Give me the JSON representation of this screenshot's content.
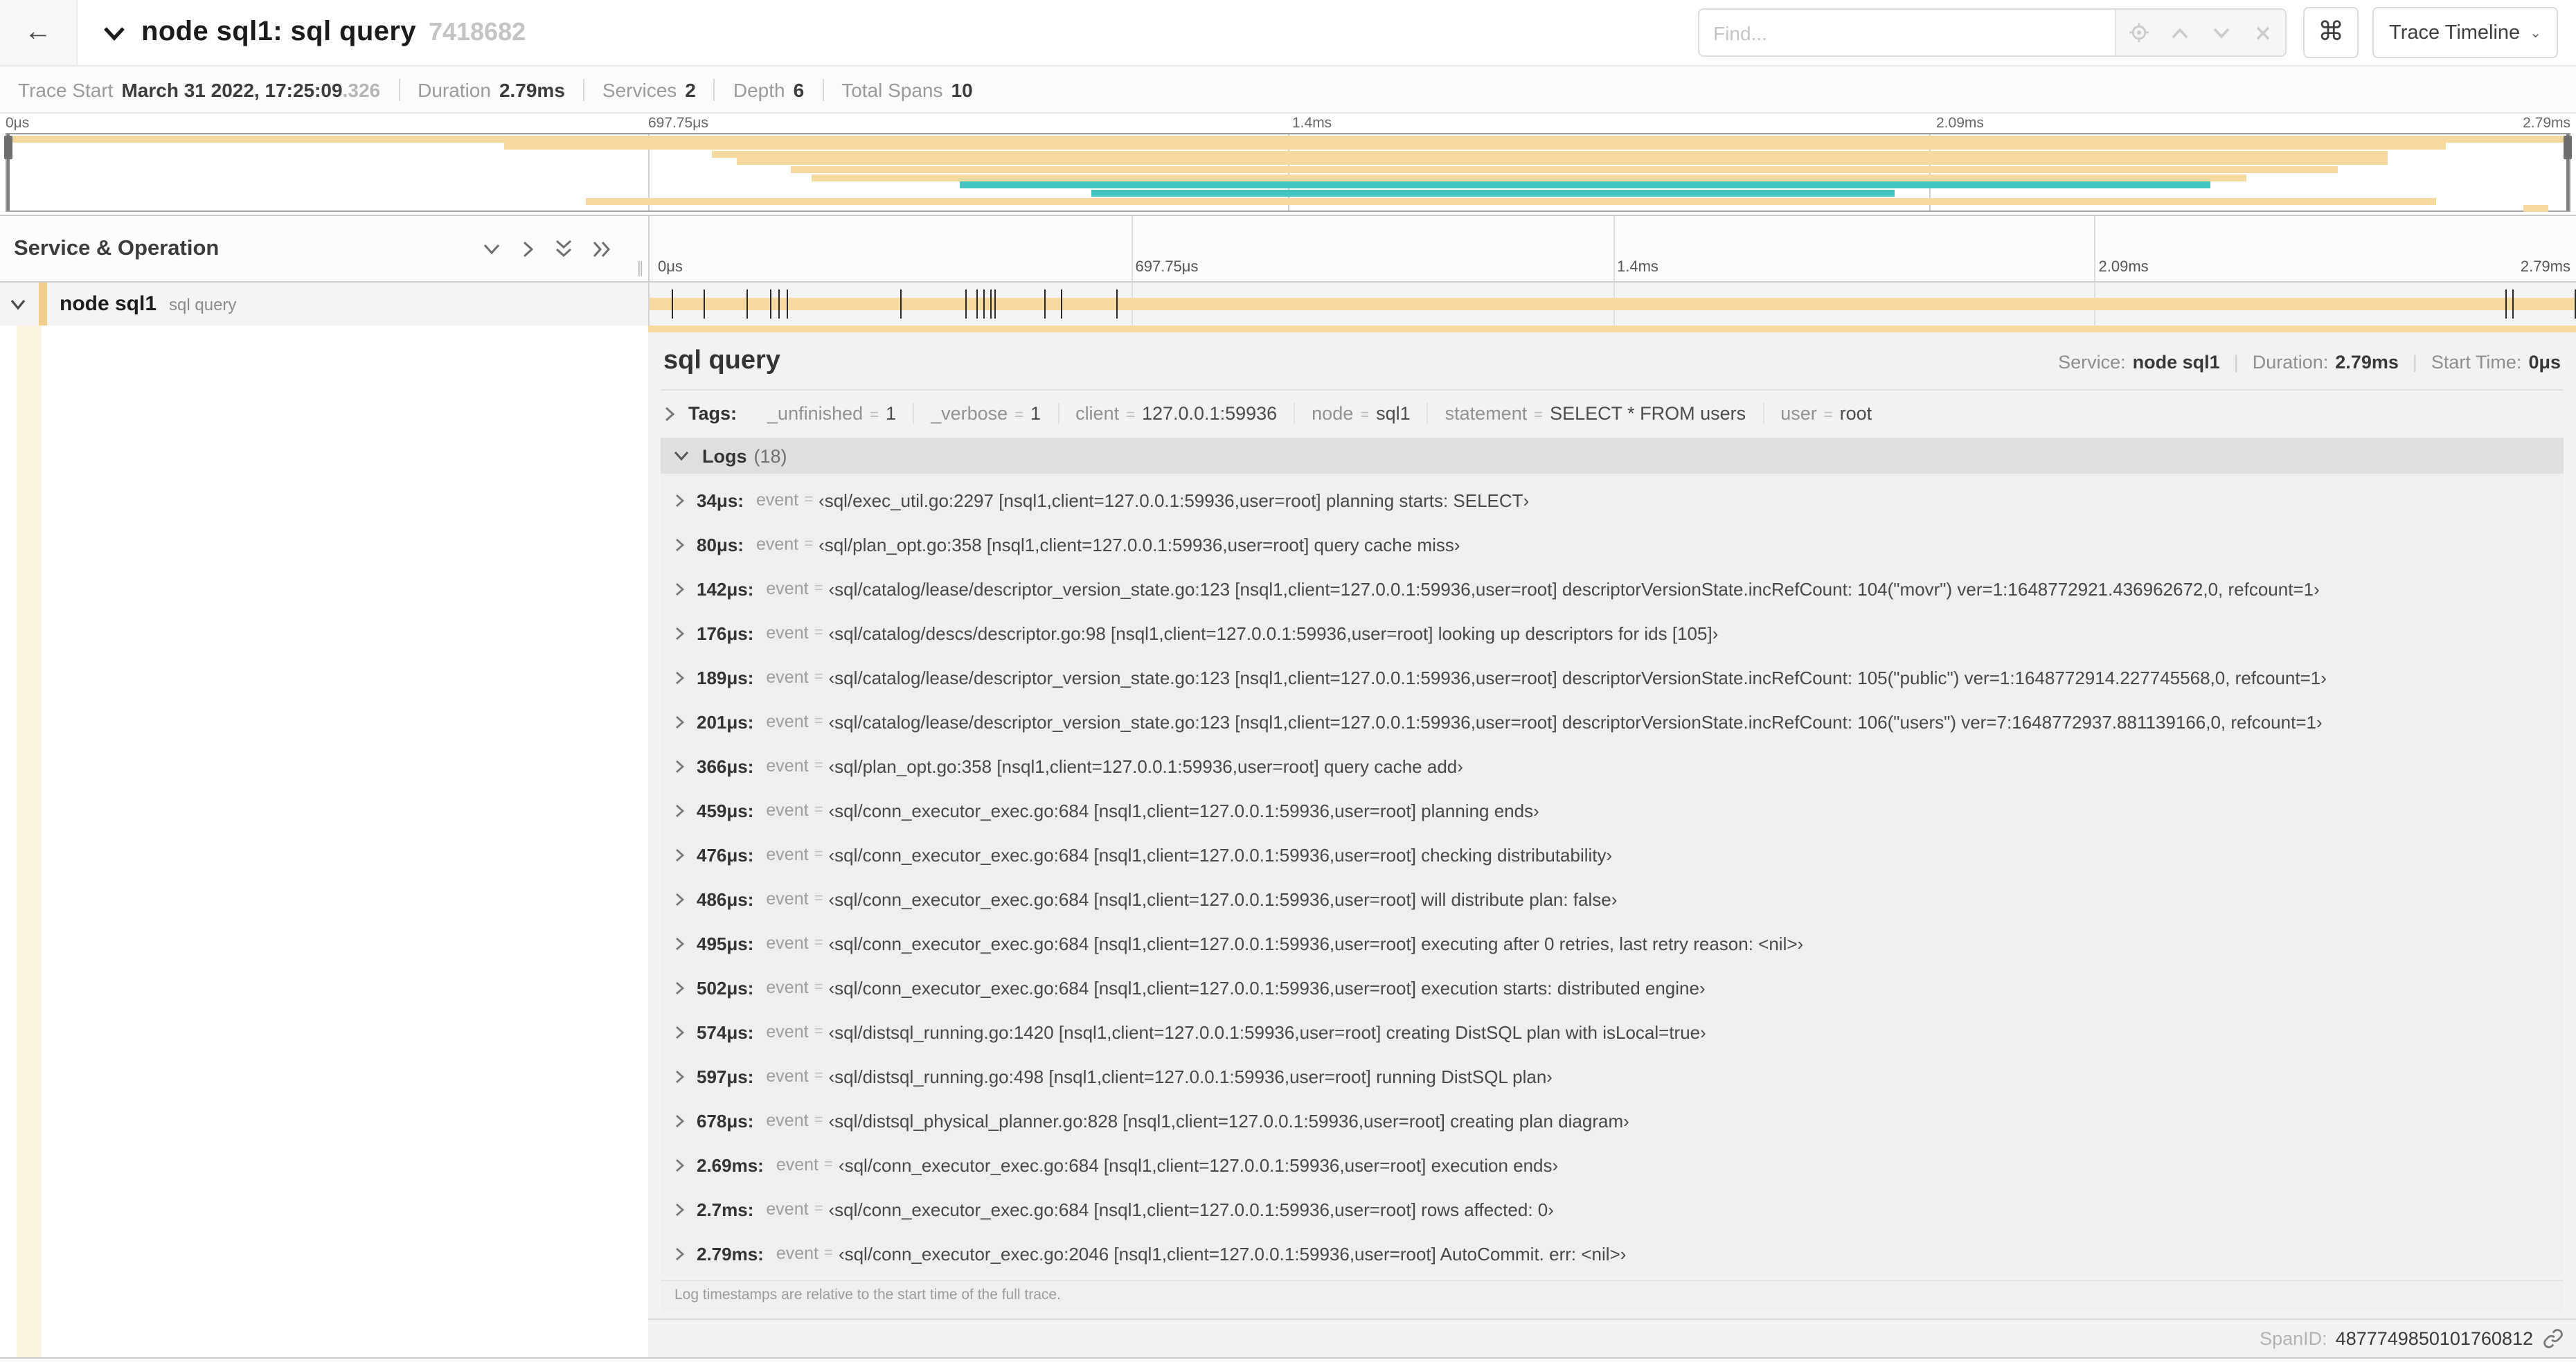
{
  "colors": {
    "tan": "#F5D9A0",
    "teal": "#41C5BF",
    "accent": "#F0CD8B",
    "cream": "#FBF4E2"
  },
  "header": {
    "back_label": "←",
    "title": "node sql1: sql query",
    "trace_id": "7418682",
    "find_placeholder": "Find...",
    "command_key": "⌘",
    "view_button_label": "Trace Timeline",
    "view_button_chevron": "⌄"
  },
  "summary": {
    "items": [
      {
        "label": "Trace Start",
        "value": "March 31 2022, 17:25:09",
        "muted": ".326"
      },
      {
        "label": "Duration",
        "value": "2.79ms",
        "muted": ""
      },
      {
        "label": "Services",
        "value": "2",
        "muted": ""
      },
      {
        "label": "Depth",
        "value": "6",
        "muted": ""
      },
      {
        "label": "Total Spans",
        "value": "10",
        "muted": ""
      }
    ]
  },
  "timeline": {
    "ticks": [
      {
        "label": "0μs",
        "pct": 0
      },
      {
        "label": "697.75μs",
        "pct": 25
      },
      {
        "label": "1.4ms",
        "pct": 50
      },
      {
        "label": "2.09ms",
        "pct": 75
      },
      {
        "label": "2.79ms",
        "pct": 100
      }
    ],
    "minimap_spans": [
      {
        "s": 0,
        "e": 100,
        "c": "tan"
      },
      {
        "s": 19.4,
        "e": 95.2,
        "c": "tan"
      },
      {
        "s": 27.5,
        "e": 92.9,
        "c": "tan"
      },
      {
        "s": 28.5,
        "e": 92.9,
        "c": "tan"
      },
      {
        "s": 30.6,
        "e": 91.0,
        "c": "tan"
      },
      {
        "s": 31.4,
        "e": 87.4,
        "c": "tan"
      },
      {
        "s": 37.2,
        "e": 86.0,
        "c": "teal"
      },
      {
        "s": 42.3,
        "e": 73.7,
        "c": "teal"
      },
      {
        "s": 22.6,
        "e": 94.8,
        "c": "tan"
      },
      {
        "s": 98.2,
        "e": 99.2,
        "c": "tan"
      }
    ],
    "left_title": "Service & Operation",
    "resizer_glyph": "∥"
  },
  "span_row": {
    "service": "node sql1",
    "operation": "sql query",
    "bar": {
      "s": 0,
      "e": 100,
      "c": "tan"
    },
    "log_marker_pcts": [
      1.22,
      2.87,
      5.09,
      6.31,
      6.77,
      7.2,
      13.12,
      16.45,
      17.06,
      17.42,
      17.74,
      18.0,
      20.57,
      21.4,
      24.3,
      96.42,
      96.77,
      100
    ]
  },
  "detail": {
    "title": "sql query",
    "meta": {
      "service_label": "Service:",
      "service": "node sql1",
      "duration_label": "Duration:",
      "duration": "2.79ms",
      "start_label": "Start Time:",
      "start": "0μs"
    },
    "tags_label": "Tags:",
    "tags": [
      {
        "key": "_unfinished",
        "value": "1"
      },
      {
        "key": "_verbose",
        "value": "1"
      },
      {
        "key": "client",
        "value": "127.0.0.1:59936"
      },
      {
        "key": "node",
        "value": "sql1"
      },
      {
        "key": "statement",
        "value": "SELECT * FROM users"
      },
      {
        "key": "user",
        "value": "root"
      }
    ],
    "logs": {
      "title": "Logs",
      "count": "(18)",
      "entries": [
        {
          "time": "34μs:",
          "key": "event",
          "value": "‹sql/exec_util.go:2297 [nsql1,client=127.0.0.1:59936,user=root] planning starts: SELECT›"
        },
        {
          "time": "80μs:",
          "key": "event",
          "value": "‹sql/plan_opt.go:358 [nsql1,client=127.0.0.1:59936,user=root] query cache miss›"
        },
        {
          "time": "142μs:",
          "key": "event",
          "value": "‹sql/catalog/lease/descriptor_version_state.go:123 [nsql1,client=127.0.0.1:59936,user=root] descriptorVersionState.incRefCount: 104(\"movr\") ver=1:1648772921.436962672,0, refcount=1›"
        },
        {
          "time": "176μs:",
          "key": "event",
          "value": "‹sql/catalog/descs/descriptor.go:98 [nsql1,client=127.0.0.1:59936,user=root] looking up descriptors for ids [105]›"
        },
        {
          "time": "189μs:",
          "key": "event",
          "value": "‹sql/catalog/lease/descriptor_version_state.go:123 [nsql1,client=127.0.0.1:59936,user=root] descriptorVersionState.incRefCount: 105(\"public\") ver=1:1648772914.227745568,0, refcount=1›"
        },
        {
          "time": "201μs:",
          "key": "event",
          "value": "‹sql/catalog/lease/descriptor_version_state.go:123 [nsql1,client=127.0.0.1:59936,user=root] descriptorVersionState.incRefCount: 106(\"users\") ver=7:1648772937.881139166,0, refcount=1›"
        },
        {
          "time": "366μs:",
          "key": "event",
          "value": "‹sql/plan_opt.go:358 [nsql1,client=127.0.0.1:59936,user=root] query cache add›"
        },
        {
          "time": "459μs:",
          "key": "event",
          "value": "‹sql/conn_executor_exec.go:684 [nsql1,client=127.0.0.1:59936,user=root] planning ends›"
        },
        {
          "time": "476μs:",
          "key": "event",
          "value": "‹sql/conn_executor_exec.go:684 [nsql1,client=127.0.0.1:59936,user=root] checking distributability›"
        },
        {
          "time": "486μs:",
          "key": "event",
          "value": "‹sql/conn_executor_exec.go:684 [nsql1,client=127.0.0.1:59936,user=root] will distribute plan: false›"
        },
        {
          "time": "495μs:",
          "key": "event",
          "value": "‹sql/conn_executor_exec.go:684 [nsql1,client=127.0.0.1:59936,user=root] executing after 0 retries, last retry reason: <nil>›"
        },
        {
          "time": "502μs:",
          "key": "event",
          "value": "‹sql/conn_executor_exec.go:684 [nsql1,client=127.0.0.1:59936,user=root] execution starts: distributed engine›"
        },
        {
          "time": "574μs:",
          "key": "event",
          "value": "‹sql/distsql_running.go:1420 [nsql1,client=127.0.0.1:59936,user=root] creating DistSQL plan with isLocal=true›"
        },
        {
          "time": "597μs:",
          "key": "event",
          "value": "‹sql/distsql_running.go:498 [nsql1,client=127.0.0.1:59936,user=root] running DistSQL plan›"
        },
        {
          "time": "678μs:",
          "key": "event",
          "value": "‹sql/distsql_physical_planner.go:828 [nsql1,client=127.0.0.1:59936,user=root] creating plan diagram›"
        },
        {
          "time": "2.69ms:",
          "key": "event",
          "value": "‹sql/conn_executor_exec.go:684 [nsql1,client=127.0.0.1:59936,user=root] execution ends›"
        },
        {
          "time": "2.7ms:",
          "key": "event",
          "value": "‹sql/conn_executor_exec.go:684 [nsql1,client=127.0.0.1:59936,user=root] rows affected: 0›"
        },
        {
          "time": "2.79ms:",
          "key": "event",
          "value": "‹sql/conn_executor_exec.go:2046 [nsql1,client=127.0.0.1:59936,user=root] AutoCommit. err: <nil>›"
        }
      ],
      "footnote": "Log timestamps are relative to the start time of the full trace."
    },
    "span_id_label": "SpanID:",
    "span_id": "4877749850101760812"
  }
}
